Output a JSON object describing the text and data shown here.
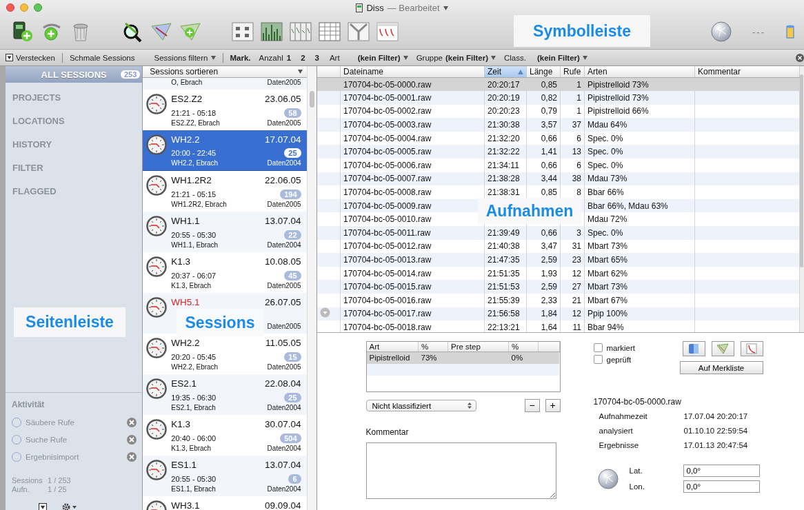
{
  "window": {
    "title": "Diss",
    "subtitle": "— Bearbeitet"
  },
  "toolbar": {
    "status": "---"
  },
  "filter_bar": {
    "hide_label": "Verstecken",
    "narrow_label": "Schmale Sessions",
    "filter_menu": "Sessions filtern",
    "mark_label": "Mark.",
    "count_label": "Anzahl",
    "counts": [
      "1",
      "2",
      "3"
    ],
    "art_label": "Art",
    "art_value": "(kein Filter)",
    "group_label": "Gruppe",
    "group_value": "(kein Filter)",
    "class_label": "Class.",
    "class_value": "(kein Filter)"
  },
  "sidebar": {
    "header": {
      "label": "ALL SESSIONS",
      "count": "253"
    },
    "items": [
      {
        "label": "PROJECTS"
      },
      {
        "label": "LOCATIONS"
      },
      {
        "label": "HISTORY"
      },
      {
        "label": "FILTER"
      },
      {
        "label": "FLAGGED"
      }
    ],
    "activity": {
      "title": "Aktivität",
      "items": [
        {
          "label": "Säubere Rufe"
        },
        {
          "label": "Suche Rufe"
        },
        {
          "label": "Ergebnisimport"
        }
      ]
    },
    "stats": [
      {
        "label": "Sessions",
        "value": "1 / 253"
      },
      {
        "label": "Aufn.",
        "value": "1 / 25"
      }
    ]
  },
  "sessions": {
    "sort_label": "Sessions sortieren",
    "items": [
      {
        "location": "O, Ebrach",
        "source": "Daten2005",
        "selected": false
      },
      {
        "name": "ES2.Z2",
        "date": "23.06.05",
        "time": "21:21 - 05:18",
        "count": "58",
        "location": "ES2.Z2, Ebrach",
        "source": "Daten2005",
        "selected": false,
        "flagged": false
      },
      {
        "name": "WH2.2",
        "date": "17.07.04",
        "time": "20:00 - 22:45",
        "count": "25",
        "location": "WH2.2, Ebrach",
        "source": "Daten2004",
        "selected": true,
        "flagged": false
      },
      {
        "name": "WH1.2R2",
        "date": "22.06.05",
        "time": "21:21 - 05:15",
        "count": "194",
        "location": "WH1.2R2, Ebrach",
        "source": "Daten2005",
        "selected": false,
        "flagged": false
      },
      {
        "name": "WH1.1",
        "date": "13.07.04",
        "time": "20:55 - 05:30",
        "count": "22",
        "location": "WH1.1, Ebrach",
        "source": "Daten2004",
        "selected": false,
        "flagged": false
      },
      {
        "name": "K1.3",
        "date": "10.08.05",
        "time": "20:37 - 06:07",
        "count": "45",
        "location": "K1.3, Ebrach",
        "source": "Daten2005",
        "selected": false,
        "flagged": false
      },
      {
        "name": "WH5.1",
        "date": "26.07.05",
        "source": "Daten2005",
        "selected": false,
        "flagged": true
      },
      {
        "name": "WH2.2",
        "date": "11.05.05",
        "time": "20:20 - 05:45",
        "count": "15",
        "location": "WH2.2, Ebrach",
        "source": "Daten2005",
        "selected": false,
        "flagged": false
      },
      {
        "name": "ES2.1",
        "date": "22.08.04",
        "time": "19:35 - 06:30",
        "count": "25",
        "location": "ES2.1, Ebrach",
        "source": "Daten2004",
        "selected": false,
        "flagged": false
      },
      {
        "name": "K1.3",
        "date": "30.07.04",
        "time": "20:40 - 06:00",
        "count": "504",
        "location": "K1.3, Ebrach",
        "source": "Daten2004",
        "selected": false,
        "flagged": false
      },
      {
        "name": "ES1.1",
        "date": "13.07.04",
        "time": "20:55 - 05:30",
        "count": "6",
        "location": "ES1.1, Ebrach",
        "source": "Daten2004",
        "selected": false,
        "flagged": false
      },
      {
        "name": "WH3.1",
        "date": "09.09.04",
        "selected": false,
        "flagged": false
      }
    ]
  },
  "recordings": {
    "columns": [
      {
        "label": "Dateiname",
        "sorted": false
      },
      {
        "label": "Zeit",
        "sorted": true
      },
      {
        "label": "Länge",
        "sorted": false
      },
      {
        "label": "Rufe",
        "sorted": false
      },
      {
        "label": "Arten",
        "sorted": false
      },
      {
        "label": "Kommentar",
        "sorted": false
      }
    ],
    "rows": [
      {
        "file": "170704-bc-05-0000.raw",
        "time": "20:20:17",
        "length": "0,85",
        "calls": "1",
        "species": "Pipistrelloid 73%",
        "selected": true,
        "marked": false
      },
      {
        "file": "170704-bc-05-0001.raw",
        "time": "20:20:19",
        "length": "0,82",
        "calls": "1",
        "species": "Pipistrelloid 73%",
        "selected": false,
        "marked": false
      },
      {
        "file": "170704-bc-05-0002.raw",
        "time": "20:20:23",
        "length": "0,79",
        "calls": "1",
        "species": "Pipistrelloid 66%",
        "selected": false,
        "marked": false
      },
      {
        "file": "170704-bc-05-0003.raw",
        "time": "21:30:38",
        "length": "3,57",
        "calls": "37",
        "species": "Mdau 64%",
        "selected": false,
        "marked": false
      },
      {
        "file": "170704-bc-05-0004.raw",
        "time": "21:32:20",
        "length": "0,66",
        "calls": "6",
        "species": "Spec. 0%",
        "selected": false,
        "marked": false
      },
      {
        "file": "170704-bc-05-0005.raw",
        "time": "21:32:22",
        "length": "1,41",
        "calls": "13",
        "species": "Spec. 0%",
        "selected": false,
        "marked": false
      },
      {
        "file": "170704-bc-05-0006.raw",
        "time": "21:34:11",
        "length": "0,66",
        "calls": "6",
        "species": "Spec. 0%",
        "selected": false,
        "marked": false
      },
      {
        "file": "170704-bc-05-0007.raw",
        "time": "21:38:28",
        "length": "3,44",
        "calls": "38",
        "species": "Mdau 73%",
        "selected": false,
        "marked": false
      },
      {
        "file": "170704-bc-05-0008.raw",
        "time": "21:38:31",
        "length": "0,85",
        "calls": "8",
        "species": "Bbar 66%",
        "selected": false,
        "marked": false
      },
      {
        "file": "170704-bc-05-0009.raw",
        "species": "Bbar 66%, Mdau 63%",
        "selected": false,
        "marked": false
      },
      {
        "file": "170704-bc-05-0010.raw",
        "species": "Mdau 72%",
        "selected": false,
        "marked": false
      },
      {
        "file": "170704-bc-05-0011.raw",
        "time": "21:39:49",
        "length": "0,66",
        "calls": "3",
        "species": "Spec. 0%",
        "selected": false,
        "marked": false
      },
      {
        "file": "170704-bc-05-0012.raw",
        "time": "21:40:38",
        "length": "3,47",
        "calls": "31",
        "species": "Mbart 73%",
        "selected": false,
        "marked": false
      },
      {
        "file": "170704-bc-05-0013.raw",
        "time": "21:47:35",
        "length": "2,59",
        "calls": "23",
        "species": "Mbart 65%",
        "selected": false,
        "marked": false
      },
      {
        "file": "170704-bc-05-0014.raw",
        "time": "21:51:35",
        "length": "1,93",
        "calls": "12",
        "species": "Mbart 62%",
        "selected": false,
        "marked": false
      },
      {
        "file": "170704-bc-05-0015.raw",
        "time": "21:51:53",
        "length": "2,59",
        "calls": "27",
        "species": "Mbart 73%",
        "selected": false,
        "marked": false
      },
      {
        "file": "170704-bc-05-0016.raw",
        "time": "21:55:39",
        "length": "2,33",
        "calls": "21",
        "species": "Mbart 67%",
        "selected": false,
        "marked": false
      },
      {
        "file": "170704-bc-05-0017.raw",
        "time": "21:56:58",
        "length": "1,84",
        "calls": "12",
        "species": "Ppip 100%",
        "selected": false,
        "marked": true
      },
      {
        "file": "170704-bc-05-0018.raw",
        "time": "22:13:21",
        "length": "1,64",
        "calls": "11",
        "species": "Bbar 94%",
        "selected": false,
        "marked": false
      }
    ]
  },
  "detail": {
    "species_table": {
      "columns": [
        "Art",
        "%",
        "Pre step",
        "%"
      ],
      "rows": [
        {
          "cells": [
            "Pipistrelloid",
            "73%",
            "",
            "0%"
          ],
          "selected": true
        }
      ]
    },
    "classification": "Nicht klassifiziert",
    "minus": "−",
    "plus": "+",
    "comment_label": "Kommentar",
    "checkboxes": [
      {
        "label": "markiert",
        "checked": false
      },
      {
        "label": "geprüft",
        "checked": false
      }
    ],
    "list_button": "Auf Merkliste",
    "file": "170704-bc-05-0000.raw",
    "info": [
      {
        "label": "Aufnahmezeit",
        "value": "17.07.04 20:20:17"
      },
      {
        "label": "analysiert",
        "value": "01.10.10 22:59:54"
      },
      {
        "label": "Ergebnisse",
        "value": "17.01.13 20:47:54"
      }
    ],
    "coordinates": [
      {
        "label": "Lat.",
        "value": "0,0°"
      },
      {
        "label": "Lon.",
        "value": "0,0°"
      }
    ]
  },
  "annotations": [
    {
      "text": "Symbolleiste"
    },
    {
      "text": "Seitenleiste"
    },
    {
      "text": "Sessions"
    },
    {
      "text": "Aufnahmen"
    }
  ]
}
